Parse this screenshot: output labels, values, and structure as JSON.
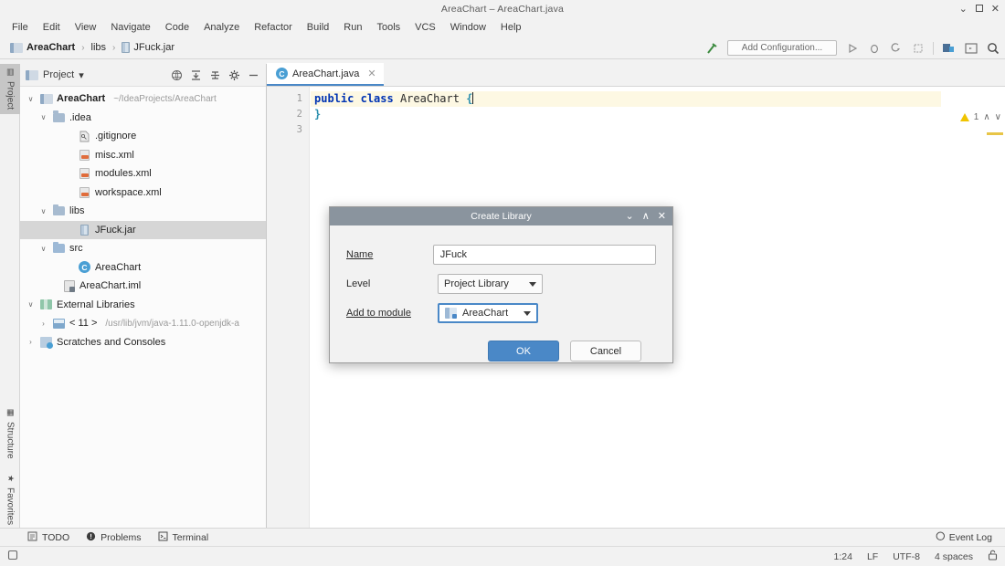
{
  "window": {
    "title": "AreaChart – AreaChart.java",
    "controls": {
      "minimize": "⌄",
      "maximize": "maximize-box",
      "close": "✕"
    }
  },
  "menubar": {
    "items": [
      "File",
      "Edit",
      "View",
      "Navigate",
      "Code",
      "Analyze",
      "Refactor",
      "Build",
      "Run",
      "Tools",
      "VCS",
      "Window",
      "Help"
    ]
  },
  "navbar": {
    "breadcrumb": [
      "AreaChart",
      "libs",
      "JFuck.jar"
    ],
    "separator": "›",
    "run_config_placeholder": "Add Configuration...",
    "icons": [
      "build-hammer-icon",
      "run-icon",
      "debug-icon",
      "run-with-coverage-icon",
      "profiler-icon",
      "git-update-icon",
      "terminal-icon",
      "search-everywhere-icon"
    ]
  },
  "left_strip": {
    "tabs": [
      {
        "label": "Project",
        "icon": "project-icon",
        "active": true
      },
      {
        "label": "Structure",
        "icon": "structure-icon",
        "active": false
      },
      {
        "label": "Favorites",
        "icon": "star-icon",
        "active": false
      }
    ]
  },
  "project_panel": {
    "title": "Project",
    "dropdown_caret": "▾",
    "toolbar_icons": [
      "locate-icon",
      "collapse-all-icon",
      "expand-all-icon",
      "settings-gear-icon",
      "hide-icon"
    ],
    "tree": [
      {
        "indent": 0,
        "arrow": "∨",
        "icon": "project-root-icon",
        "label": "AreaChart",
        "bold": true,
        "sub": "~/IdeaProjects/AreaChart",
        "selected": false
      },
      {
        "indent": 1,
        "arrow": "∨",
        "icon": "folder-icon",
        "label": ".idea",
        "bold": false,
        "sub": "",
        "selected": false
      },
      {
        "indent": 2,
        "arrow": "",
        "icon": "gitignore-icon",
        "label": ".gitignore",
        "bold": false,
        "sub": "",
        "selected": false
      },
      {
        "indent": 2,
        "arrow": "",
        "icon": "xml-file-icon",
        "label": "misc.xml",
        "bold": false,
        "sub": "",
        "selected": false
      },
      {
        "indent": 2,
        "arrow": "",
        "icon": "xml-file-icon",
        "label": "modules.xml",
        "bold": false,
        "sub": "",
        "selected": false
      },
      {
        "indent": 2,
        "arrow": "",
        "icon": "xml-file-icon",
        "label": "workspace.xml",
        "bold": false,
        "sub": "",
        "selected": false
      },
      {
        "indent": 1,
        "arrow": "∨",
        "icon": "folder-icon",
        "label": "libs",
        "bold": false,
        "sub": "",
        "selected": false
      },
      {
        "indent": 2,
        "arrow": "",
        "icon": "jar-file-icon",
        "label": "JFuck.jar",
        "bold": false,
        "sub": "",
        "selected": true
      },
      {
        "indent": 1,
        "arrow": "∨",
        "icon": "source-folder-icon",
        "label": "src",
        "bold": false,
        "sub": "",
        "selected": false
      },
      {
        "indent": 2,
        "arrow": "",
        "icon": "java-class-icon",
        "label": "AreaChart",
        "bold": false,
        "sub": "",
        "selected": false
      },
      {
        "indent": 1,
        "arrow": "",
        "icon": "iml-file-icon",
        "label": "AreaChart.iml",
        "bold": false,
        "sub": "",
        "selected": false
      },
      {
        "indent": 0,
        "arrow": "∨",
        "icon": "external-libraries-icon",
        "label": "External Libraries",
        "bold": false,
        "sub": "",
        "selected": false
      },
      {
        "indent": 1,
        "arrow": "›",
        "icon": "jdk-icon",
        "label": "< 11 >",
        "bold": false,
        "sub": "/usr/lib/jvm/java-1.11.0-openjdk-a",
        "selected": false
      },
      {
        "indent": 0,
        "arrow": "›",
        "icon": "scratches-icon",
        "label": "Scratches and Consoles",
        "bold": false,
        "sub": "",
        "selected": false
      }
    ]
  },
  "editor": {
    "tab": {
      "label": "AreaChart.java",
      "icon": "java-class-icon",
      "close": "✕"
    },
    "line_numbers": [
      "1",
      "2",
      "3"
    ],
    "code": {
      "line1_kw1": "public",
      "line1_kw2": "class",
      "line1_name": "AreaChart",
      "line1_brace": "{",
      "line2_brace": "}"
    },
    "inspection": {
      "warning_count": "1",
      "up_arrow": "∧",
      "down_arrow": "∨"
    }
  },
  "dialog": {
    "title": "Create Library",
    "controls": {
      "minimize": "⌄",
      "maximize": "∧",
      "close": "✕"
    },
    "fields": {
      "name_label": "Name",
      "name_value": "JFuck",
      "level_label": "Level",
      "level_value": "Project Library",
      "module_label": "Add to module",
      "module_value": "AreaChart",
      "module_icon": "module-icon"
    },
    "buttons": {
      "ok": "OK",
      "cancel": "Cancel"
    }
  },
  "bottom_bar": {
    "tabs": [
      {
        "label": "TODO",
        "icon": "todo-icon"
      },
      {
        "label": "Problems",
        "icon": "problems-icon"
      },
      {
        "label": "Terminal",
        "icon": "terminal-icon"
      }
    ],
    "event_log": {
      "label": "Event Log",
      "icon": "event-log-icon"
    }
  },
  "status_bar": {
    "caret_position": "1:24",
    "line_separator": "LF",
    "encoding": "UTF-8",
    "indent": "4 spaces",
    "lock_icon": "lock-icon",
    "left_icon": "memory-indicator-icon"
  },
  "colors": {
    "accent_blue": "#4a88c7",
    "selection_gray": "#d6d6d6",
    "dialog_header": "#8a949e",
    "warning_yellow": "#f0c400",
    "keyword_blue": "#0033b3"
  }
}
